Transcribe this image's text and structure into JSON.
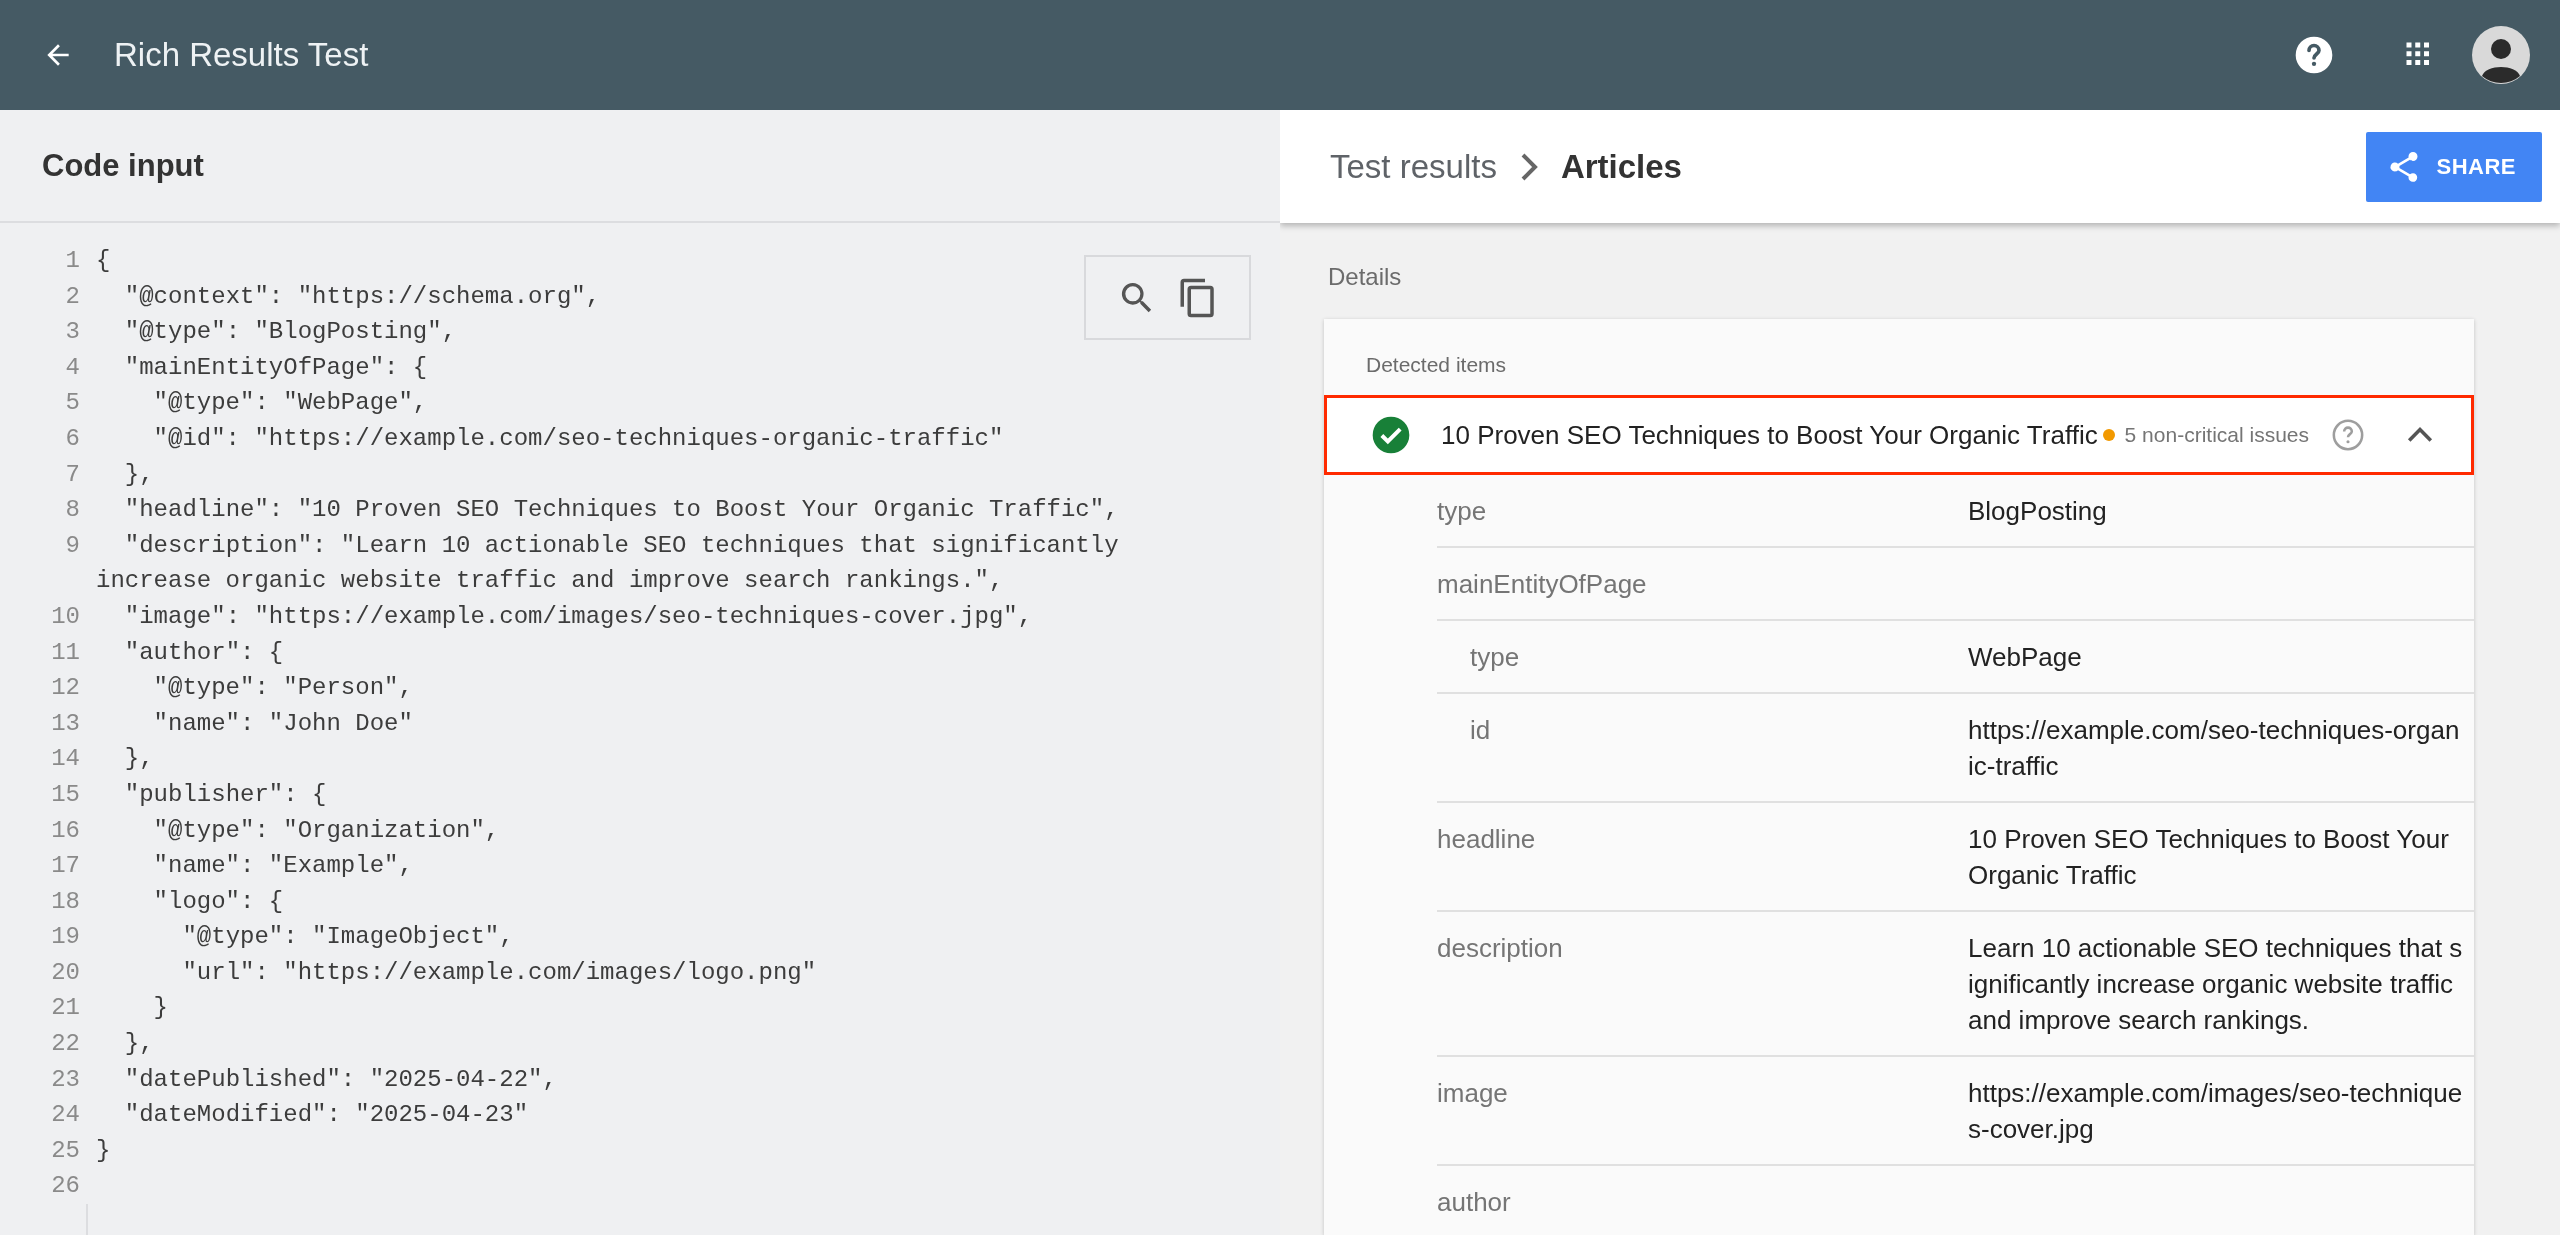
{
  "app_bar": {
    "title": "Rich Results Test"
  },
  "code_input": {
    "title": "Code input",
    "lines": [
      {
        "number": "1",
        "text": "{"
      },
      {
        "number": "2",
        "text": "  \"@context\": \"https://schema.org\","
      },
      {
        "number": "3",
        "text": "  \"@type\": \"BlogPosting\","
      },
      {
        "number": "4",
        "text": "  \"mainEntityOfPage\": {"
      },
      {
        "number": "5",
        "text": "    \"@type\": \"WebPage\","
      },
      {
        "number": "6",
        "text": "    \"@id\": \"https://example.com/seo-techniques-organic-traffic\""
      },
      {
        "number": "7",
        "text": "  },"
      },
      {
        "number": "8",
        "text": "  \"headline\": \"10 Proven SEO Techniques to Boost Your Organic Traffic\","
      },
      {
        "number": "9",
        "text": "  \"description\": \"Learn 10 actionable SEO techniques that significantly increase organic website traffic and improve search rankings.\","
      },
      {
        "number": "10",
        "text": "  \"image\": \"https://example.com/images/seo-techniques-cover.jpg\","
      },
      {
        "number": "11",
        "text": "  \"author\": {"
      },
      {
        "number": "12",
        "text": "    \"@type\": \"Person\","
      },
      {
        "number": "13",
        "text": "    \"name\": \"John Doe\""
      },
      {
        "number": "14",
        "text": "  },"
      },
      {
        "number": "15",
        "text": "  \"publisher\": {"
      },
      {
        "number": "16",
        "text": "    \"@type\": \"Organization\","
      },
      {
        "number": "17",
        "text": "    \"name\": \"Example\","
      },
      {
        "number": "18",
        "text": "    \"logo\": {"
      },
      {
        "number": "19",
        "text": "      \"@type\": \"ImageObject\","
      },
      {
        "number": "20",
        "text": "      \"url\": \"https://example.com/images/logo.png\""
      },
      {
        "number": "21",
        "text": "    }"
      },
      {
        "number": "22",
        "text": "  },"
      },
      {
        "number": "23",
        "text": "  \"datePublished\": \"2025-04-22\","
      },
      {
        "number": "24",
        "text": "  \"dateModified\": \"2025-04-23\""
      },
      {
        "number": "25",
        "text": "}"
      },
      {
        "number": "26"
      }
    ]
  },
  "results": {
    "breadcrumb": [
      {
        "label": "Test results"
      },
      {
        "label": "Articles"
      }
    ],
    "share_button": "SHARE",
    "details_label": "Details",
    "detected_items_label": "Detected items",
    "item": {
      "title": "10 Proven SEO Techniques to Boost Your Organic Traffic",
      "valid": true,
      "issues": "5 non-critical issues",
      "expanded": true,
      "highlighted": true
    },
    "properties": [
      {
        "name": "type",
        "value": "BlogPosting"
      },
      {
        "name": "mainEntityOfPage",
        "children": [
          {
            "name": "type",
            "value": "WebPage"
          },
          {
            "name": "id",
            "value": "https://example.com/seo-techniques-organic-traffic"
          }
        ]
      },
      {
        "name": "headline",
        "value": "10 Proven SEO Techniques to Boost Your Organic Traffic"
      },
      {
        "name": "description",
        "value": "Learn 10 actionable SEO techniques that significantly increase organic website traffic and improve search rankings."
      },
      {
        "name": "image",
        "value": "https://example.com/images/seo-techniques-cover.jpg"
      },
      {
        "name": "author"
      }
    ]
  }
}
